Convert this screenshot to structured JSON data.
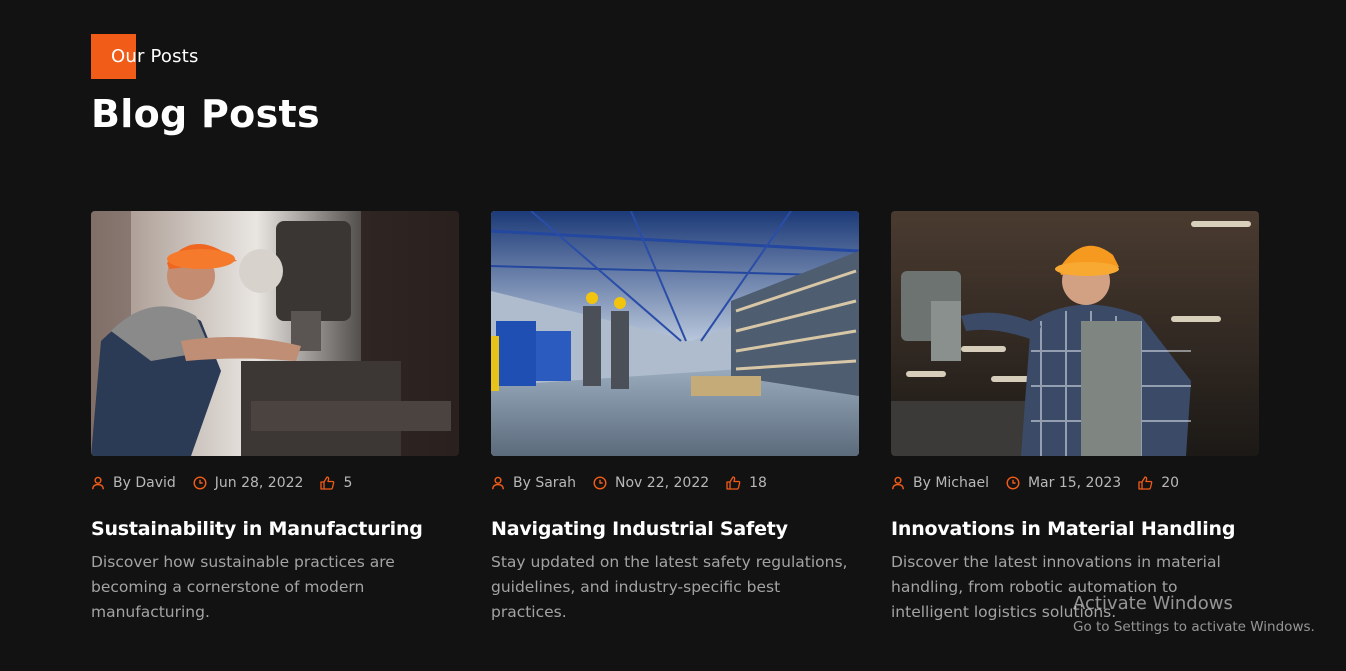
{
  "section": {
    "eyebrow": "Our Posts",
    "title": "Blog Posts",
    "accent_color": "#f25c19"
  },
  "posts": [
    {
      "author": "By David",
      "date": "Jun 28, 2022",
      "likes": "5",
      "title": "Sustainability in Manufacturing",
      "description": "Discover how sustainable practices are becoming a cornerstone of modern manufacturing.",
      "image": "worker in orange hard hat operating a milling machine"
    },
    {
      "author": "By Sarah",
      "date": "Nov 22, 2022",
      "likes": "18",
      "title": "Navigating Industrial Safety",
      "description": "Stay updated on the latest safety regulations, guidelines, and industry-specific best practices.",
      "image": "two workers in hard hats walking through a large warehouse"
    },
    {
      "author": "By Michael",
      "date": "Mar 15, 2023",
      "likes": "20",
      "title": "Innovations in Material Handling",
      "description": "Discover the latest innovations in material handling, from robotic automation to intelligent logistics solutions.",
      "image": "worker in orange hard hat and plaid shirt at a drilling machine"
    }
  ],
  "icons": {
    "author": "user-icon",
    "date": "clock-icon",
    "likes": "thumbs-up-icon"
  },
  "os_overlay": {
    "title": "Activate Windows",
    "subtitle": "Go to Settings to activate Windows."
  }
}
